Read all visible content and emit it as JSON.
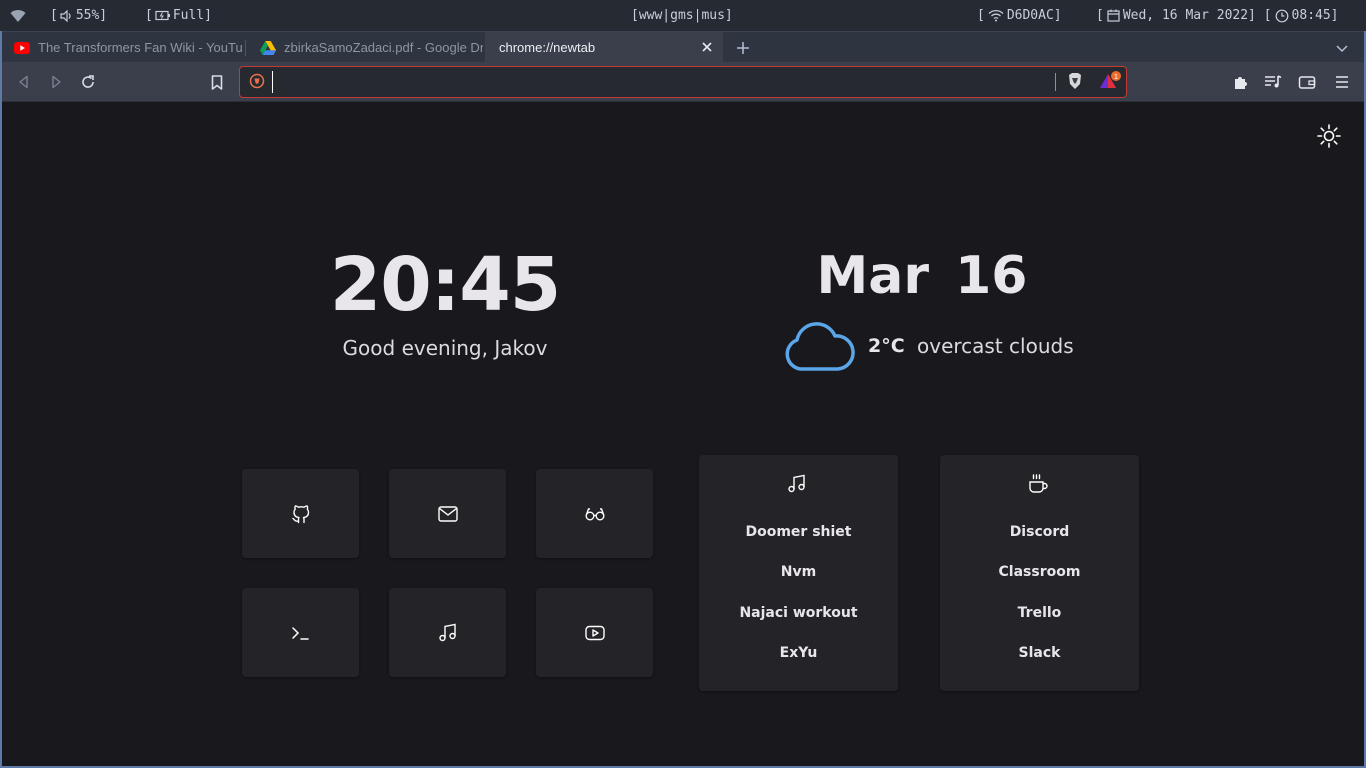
{
  "sysbar": {
    "volume": "55%]",
    "battery": "Full]",
    "workspaces": "[www|gms|mus]",
    "network": "D6D0AC]",
    "date": "Wed, 16 Mar 2022] [",
    "time": "08:45]"
  },
  "tabs": [
    {
      "label": "The Transformers Fan Wiki - YouTube",
      "favicon": "youtube-icon"
    },
    {
      "label": "zbirkaSamoZadaci.pdf - Google Drive",
      "favicon": "google-drive-icon"
    },
    {
      "label": "chrome://newtab",
      "active": true
    }
  ],
  "omnibox": {
    "value": "",
    "placeholder": ""
  },
  "colors": {
    "accent_border": "#c23b35",
    "weather_icon": "#5aa6e8",
    "frame": "#5e7aa8"
  },
  "newtab": {
    "clock": "20:45",
    "greeting": "Good evening, Jakov",
    "date": "Mar 16",
    "weather": {
      "icon": "cloud-icon",
      "temp": "2°C",
      "description": "overcast clouds"
    },
    "tiles": [
      {
        "icon": "github-icon"
      },
      {
        "icon": "mail-icon"
      },
      {
        "icon": "glasses-icon"
      },
      {
        "icon": "terminal-icon"
      },
      {
        "icon": "music-icon"
      },
      {
        "icon": "youtube-icon"
      }
    ],
    "cards": [
      {
        "icon": "music-icon",
        "links": [
          "Doomer shiet",
          "Nvm",
          "Najaci workout",
          "ExYu"
        ]
      },
      {
        "icon": "coffee-icon",
        "links": [
          "Discord",
          "Classroom",
          "Trello",
          "Slack"
        ]
      }
    ]
  }
}
